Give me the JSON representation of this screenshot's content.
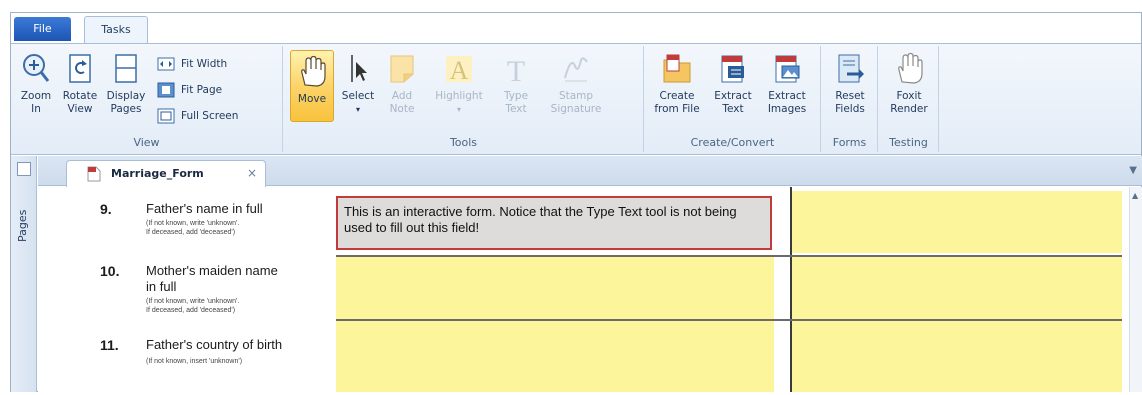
{
  "tabs": {
    "file": "File",
    "tasks": "Tasks"
  },
  "ribbon": {
    "view": {
      "label": "View",
      "zoom_in": "Zoom\nIn",
      "rotate_view": "Rotate\nView",
      "display_pages": "Display\nPages",
      "fit_width": "Fit Width",
      "fit_page": "Fit Page",
      "full_screen": "Full Screen"
    },
    "tools": {
      "label": "Tools",
      "move": "Move",
      "select": "Select",
      "add_note": "Add\nNote",
      "highlight": "Highlight",
      "type_text": "Type\nText",
      "stamp_signature": "Stamp\nSignature"
    },
    "create_convert": {
      "label": "Create/Convert",
      "create_from_file": "Create\nfrom File",
      "extract_text": "Extract\nText",
      "extract_images": "Extract\nImages"
    },
    "forms": {
      "label": "Forms",
      "reset_fields": "Reset\nFields"
    },
    "testing": {
      "label": "Testing",
      "foxit_render": "Foxit\nRender"
    }
  },
  "pages_pane": {
    "label": "Pages"
  },
  "document_tab": {
    "title": "Marriage_Form",
    "close": "×"
  },
  "form": {
    "rows": [
      {
        "number": "9.",
        "question": "Father's name in full",
        "note": "(If not known, write 'unknown'.\nIf deceased, add 'deceased')"
      },
      {
        "number": "10.",
        "question": "Mother's maiden name\nin full",
        "note": "(If not known, write 'unknown'.\nIf deceased, add 'deceased')"
      },
      {
        "number": "11.",
        "question": "Father's country of birth",
        "note": "(If not known, insert 'unknown')"
      }
    ],
    "active_field_text": "This is an interactive form. Notice that the Type Text tool is not being used to fill out this field!"
  },
  "colors": {
    "field": "#fdf59c",
    "active_border": "#c23b3b",
    "ribbon_bg": "#e3ecf7"
  }
}
